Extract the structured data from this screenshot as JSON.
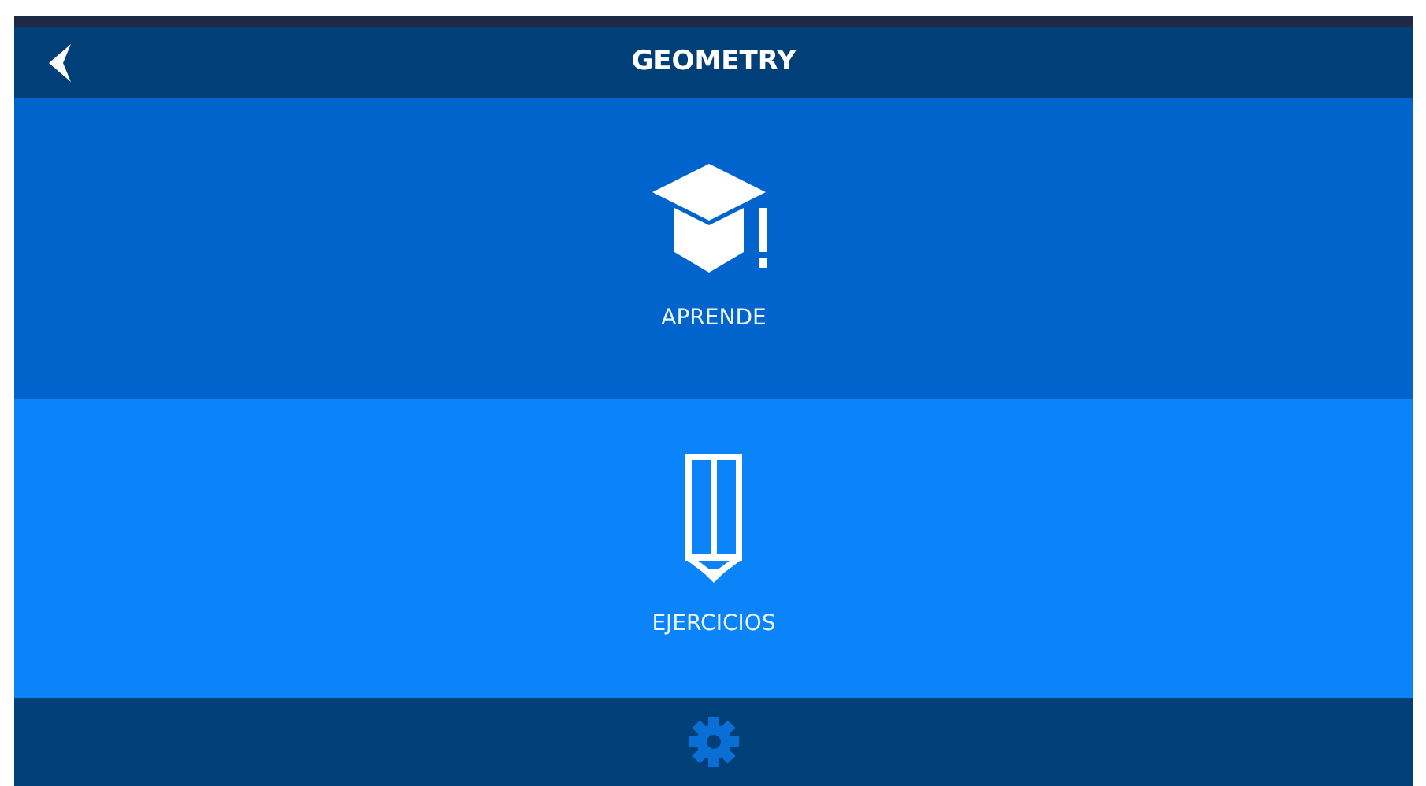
{
  "header": {
    "title": "GEOMETRY"
  },
  "menu": [
    {
      "label": "APRENDE",
      "kind": "learn",
      "color": "#0064cc"
    },
    {
      "label": "EJERCICIOS",
      "kind": "exercises",
      "color": "#0a84f8"
    }
  ]
}
